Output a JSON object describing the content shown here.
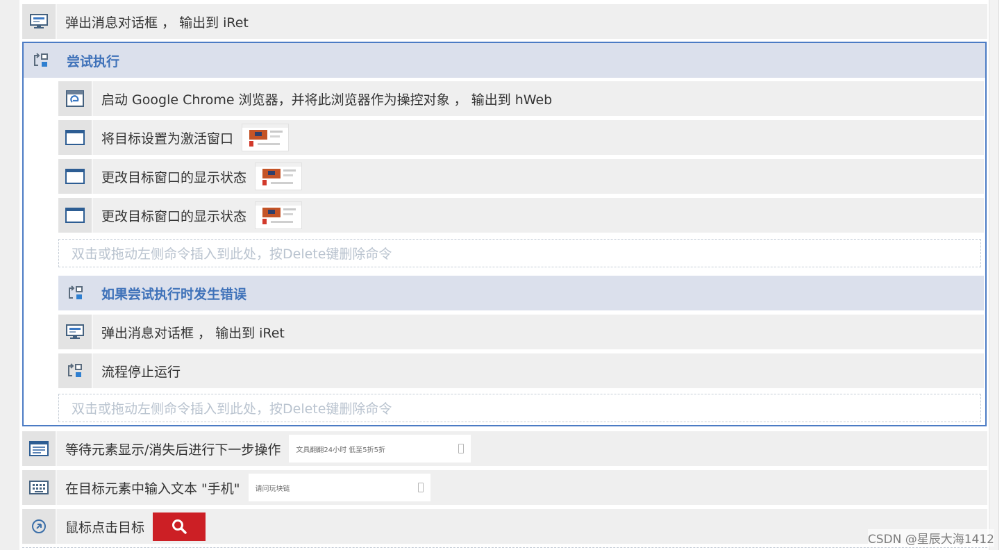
{
  "steps": {
    "msgbox_top": "弹出消息对话框 ， 输出到 iRet",
    "try_header": "尝试执行",
    "launch_chrome": "启动 Google Chrome 浏览器，并将此浏览器作为操控对象 ， 输出到 hWeb",
    "set_active": "将目标设置为激活窗口",
    "change_state_1": "更改目标窗口的显示状态",
    "change_state_2": "更改目标窗口的显示状态",
    "drop_hint_1": "双击或拖动左侧命令插入到此处，按Delete键删除命令",
    "catch_header": "如果尝试执行时发生错误",
    "msgbox_inner": "弹出消息对话框 ， 输出到 iRet",
    "stop_flow": "流程停止运行",
    "drop_hint_2": "双击或拖动左侧命令插入到此处，按Delete键删除命令",
    "wait_element": "等待元素显示/消失后进行下一步操作",
    "wait_element_preview": "文具翻翻24小时 低至5折5折",
    "input_text": "在目标元素中输入文本 \"手机\"",
    "input_text_preview": "请问玩块链",
    "mouse_click": "鼠标点击目标"
  },
  "watermark": "CSDN @星辰大海1412",
  "colors": {
    "accent_blue": "#4b7bc4",
    "header_text": "#3f72b9",
    "header_bg": "#dbe0ec",
    "row_bg": "#efefef",
    "search_red": "#cc1f25"
  },
  "icons": [
    "monitor-icon",
    "try-flow-icon",
    "browser-icon",
    "window-icon",
    "form-icon",
    "keyboard-icon",
    "target-icon",
    "search-icon",
    "trash-icon"
  ]
}
